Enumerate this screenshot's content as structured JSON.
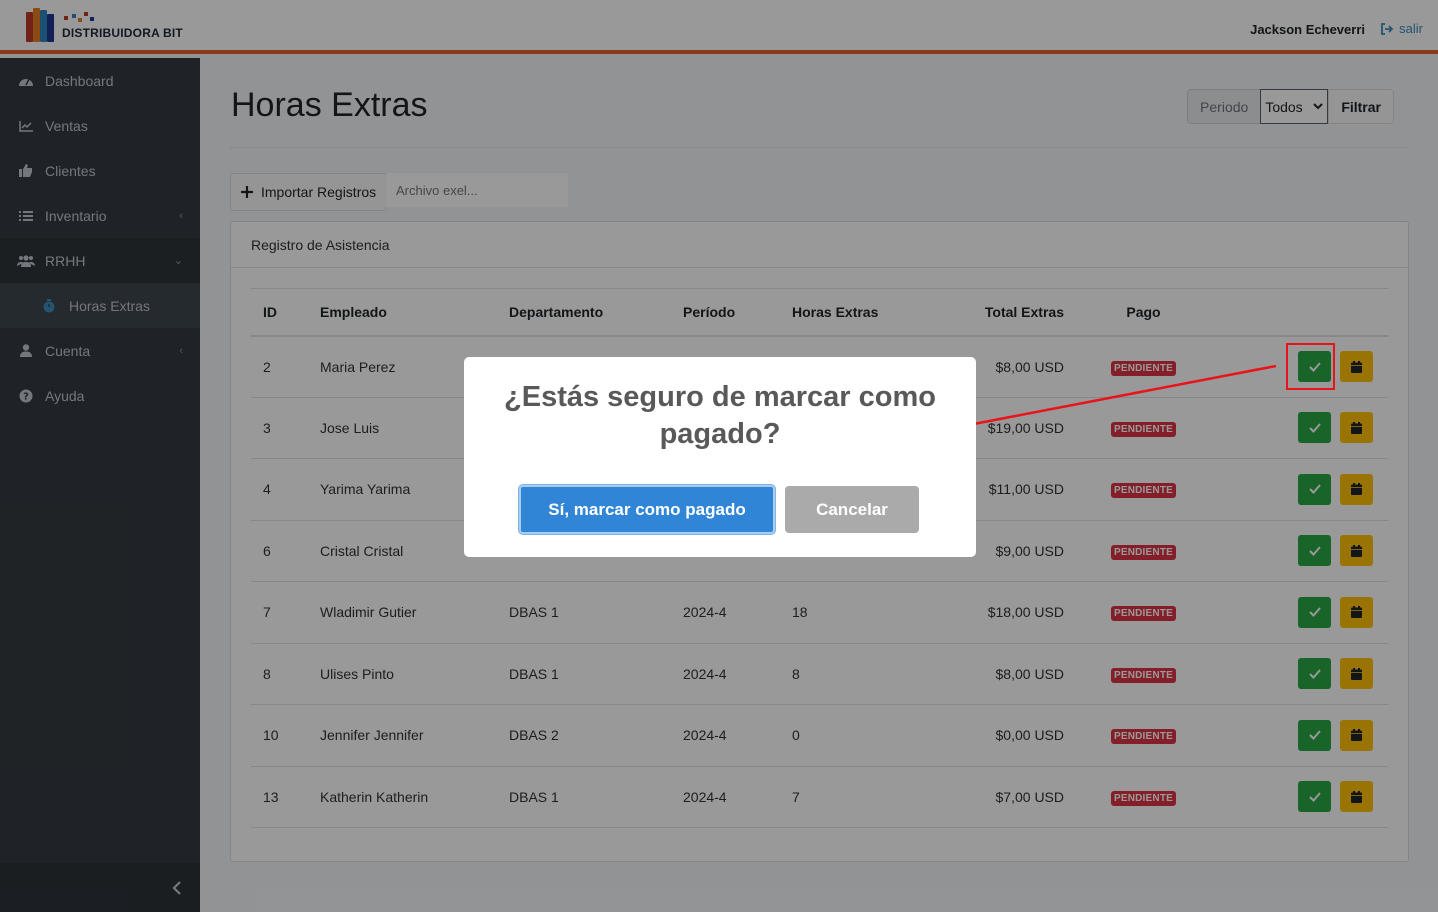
{
  "header": {
    "brand": "DISTRIBUIDORA BIT",
    "user_name": "Jackson Echeverri",
    "logout_label": "salir"
  },
  "sidebar": {
    "items": [
      {
        "label": "Dashboard",
        "icon": "dashboard-icon"
      },
      {
        "label": "Ventas",
        "icon": "chart-line-icon"
      },
      {
        "label": "Clientes",
        "icon": "thumbs-up-icon"
      },
      {
        "label": "Inventario",
        "icon": "list-icon"
      },
      {
        "label": "RRHH",
        "icon": "users-icon"
      },
      {
        "label": "Horas Extras",
        "icon": "stopwatch-icon"
      },
      {
        "label": "Cuenta",
        "icon": "user-icon"
      },
      {
        "label": "Ayuda",
        "icon": "question-circle-icon"
      }
    ]
  },
  "page": {
    "title": "Horas Extras",
    "filter_label": "Periodo",
    "filter_value": "Todos",
    "filter_button": "Filtrar",
    "import_button": "Importar Registros",
    "file_placeholder": "Archivo exel..."
  },
  "card": {
    "header": "Registro de Asistencia"
  },
  "table": {
    "headers": [
      "ID",
      "Empleado",
      "Departamento",
      "Período",
      "Horas Extras",
      "Total Extras",
      "Pago"
    ],
    "rows": [
      {
        "id": "2",
        "empleado": "Maria Perez",
        "departamento": "",
        "periodo": "",
        "horas": "",
        "total": "$8,00 USD",
        "pago": "PENDIENTE"
      },
      {
        "id": "3",
        "empleado": "Jose Luis",
        "departamento": "",
        "periodo": "",
        "horas": "",
        "total": "$19,00 USD",
        "pago": "PENDIENTE"
      },
      {
        "id": "4",
        "empleado": "Yarima Yarima",
        "departamento": "",
        "periodo": "",
        "horas": "",
        "total": "$11,00 USD",
        "pago": "PENDIENTE"
      },
      {
        "id": "6",
        "empleado": "Cristal Cristal",
        "departamento": "",
        "periodo": "",
        "horas": "",
        "total": "$9,00 USD",
        "pago": "PENDIENTE"
      },
      {
        "id": "7",
        "empleado": "Wladimir Gutier",
        "departamento": "DBAS 1",
        "periodo": "2024-4",
        "horas": "18",
        "total": "$18,00 USD",
        "pago": "PENDIENTE"
      },
      {
        "id": "8",
        "empleado": "Ulises Pinto",
        "departamento": "DBAS 1",
        "periodo": "2024-4",
        "horas": "8",
        "total": "$8,00 USD",
        "pago": "PENDIENTE"
      },
      {
        "id": "10",
        "empleado": "Jennifer Jennifer",
        "departamento": "DBAS 2",
        "periodo": "2024-4",
        "horas": "0",
        "total": "$0,00 USD",
        "pago": "PENDIENTE"
      },
      {
        "id": "13",
        "empleado": "Katherin Katherin",
        "departamento": "DBAS 1",
        "periodo": "2024-4",
        "horas": "7",
        "total": "$7,00 USD",
        "pago": "PENDIENTE"
      }
    ]
  },
  "modal": {
    "title": "¿Estás seguro de marcar como pagado?",
    "confirm_label": "Sí, marcar como pagado",
    "cancel_label": "Cancelar"
  },
  "colors": {
    "accent": "#e8622a",
    "sidebar": "#343a40",
    "confirm": "#3085d6",
    "success": "#28a745",
    "warning": "#ffc107",
    "danger": "#dc3545",
    "annotation": "#e8141a"
  }
}
